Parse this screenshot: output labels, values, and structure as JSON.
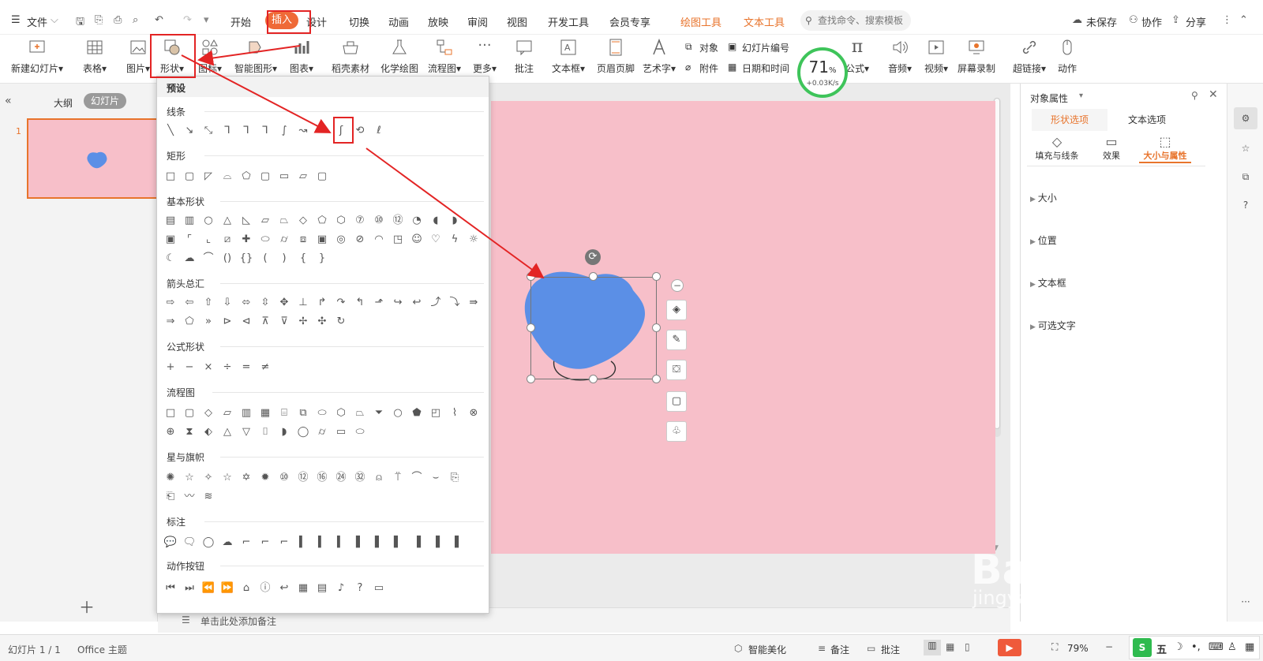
{
  "menu": {
    "file": "文件",
    "tabs": [
      "开始",
      "插入",
      "设计",
      "切换",
      "动画",
      "放映",
      "审阅",
      "视图",
      "开发工具",
      "会员专享"
    ],
    "context_tabs": [
      "绘图工具",
      "文本工具"
    ],
    "search_placeholder": "查找命令、搜索模板",
    "unsaved": "未保存",
    "collab": "协作",
    "share": "分享"
  },
  "ribbon": {
    "new_slide": "新建幻灯片",
    "table": "表格",
    "picture": "图片",
    "shape": "形状",
    "icon": "图标",
    "smartart": "智能图形",
    "chart": "图表",
    "material": "稻壳素材",
    "chemistry": "化学绘图",
    "flowchart": "流程图",
    "more": "更多",
    "comment": "批注",
    "textbox": "文本框",
    "header_footer": "页眉页脚",
    "wordart": "艺术字",
    "object": "对象",
    "attachment": "附件",
    "slide_number": "幻灯片编号",
    "datetime": "日期和时间",
    "formula": "公式",
    "audio": "音频",
    "video": "视频",
    "screen_record": "屏幕录制",
    "hyperlink": "超链接",
    "action": "动作"
  },
  "speed": {
    "percent": "71",
    "unit": "%",
    "rate": "+0.03K/s"
  },
  "left_panel": {
    "outline": "大纲",
    "slides": "幻灯片",
    "slide_num": "1"
  },
  "dropdown": {
    "header": "预设",
    "sections": [
      "线条",
      "矩形",
      "基本形状",
      "箭头总汇",
      "公式形状",
      "流程图",
      "星与旗帜",
      "标注",
      "动作按钮"
    ]
  },
  "notes": "单击此处添加备注",
  "right_panel": {
    "title": "对象属性",
    "tab_shape": "形状选项",
    "tab_text": "文本选项",
    "fill": "填充与线条",
    "effect": "效果",
    "size_prop": "大小与属性",
    "sections": [
      "大小",
      "位置",
      "文本框",
      "可选文字"
    ]
  },
  "status": {
    "slide_info": "幻灯片 1 / 1",
    "theme": "Office 主题",
    "beautify": "智能美化",
    "notes": "备注",
    "comment": "批注",
    "zoom": "79%"
  },
  "watermark": {
    "brand": "Bai du 经验",
    "url": "jingyan.baidu.com"
  },
  "colors": {
    "accent": "#ef6a37",
    "slide_bg": "#f7bfc9",
    "shape_fill": "#5b8fe6",
    "annotation": "#e32424"
  }
}
